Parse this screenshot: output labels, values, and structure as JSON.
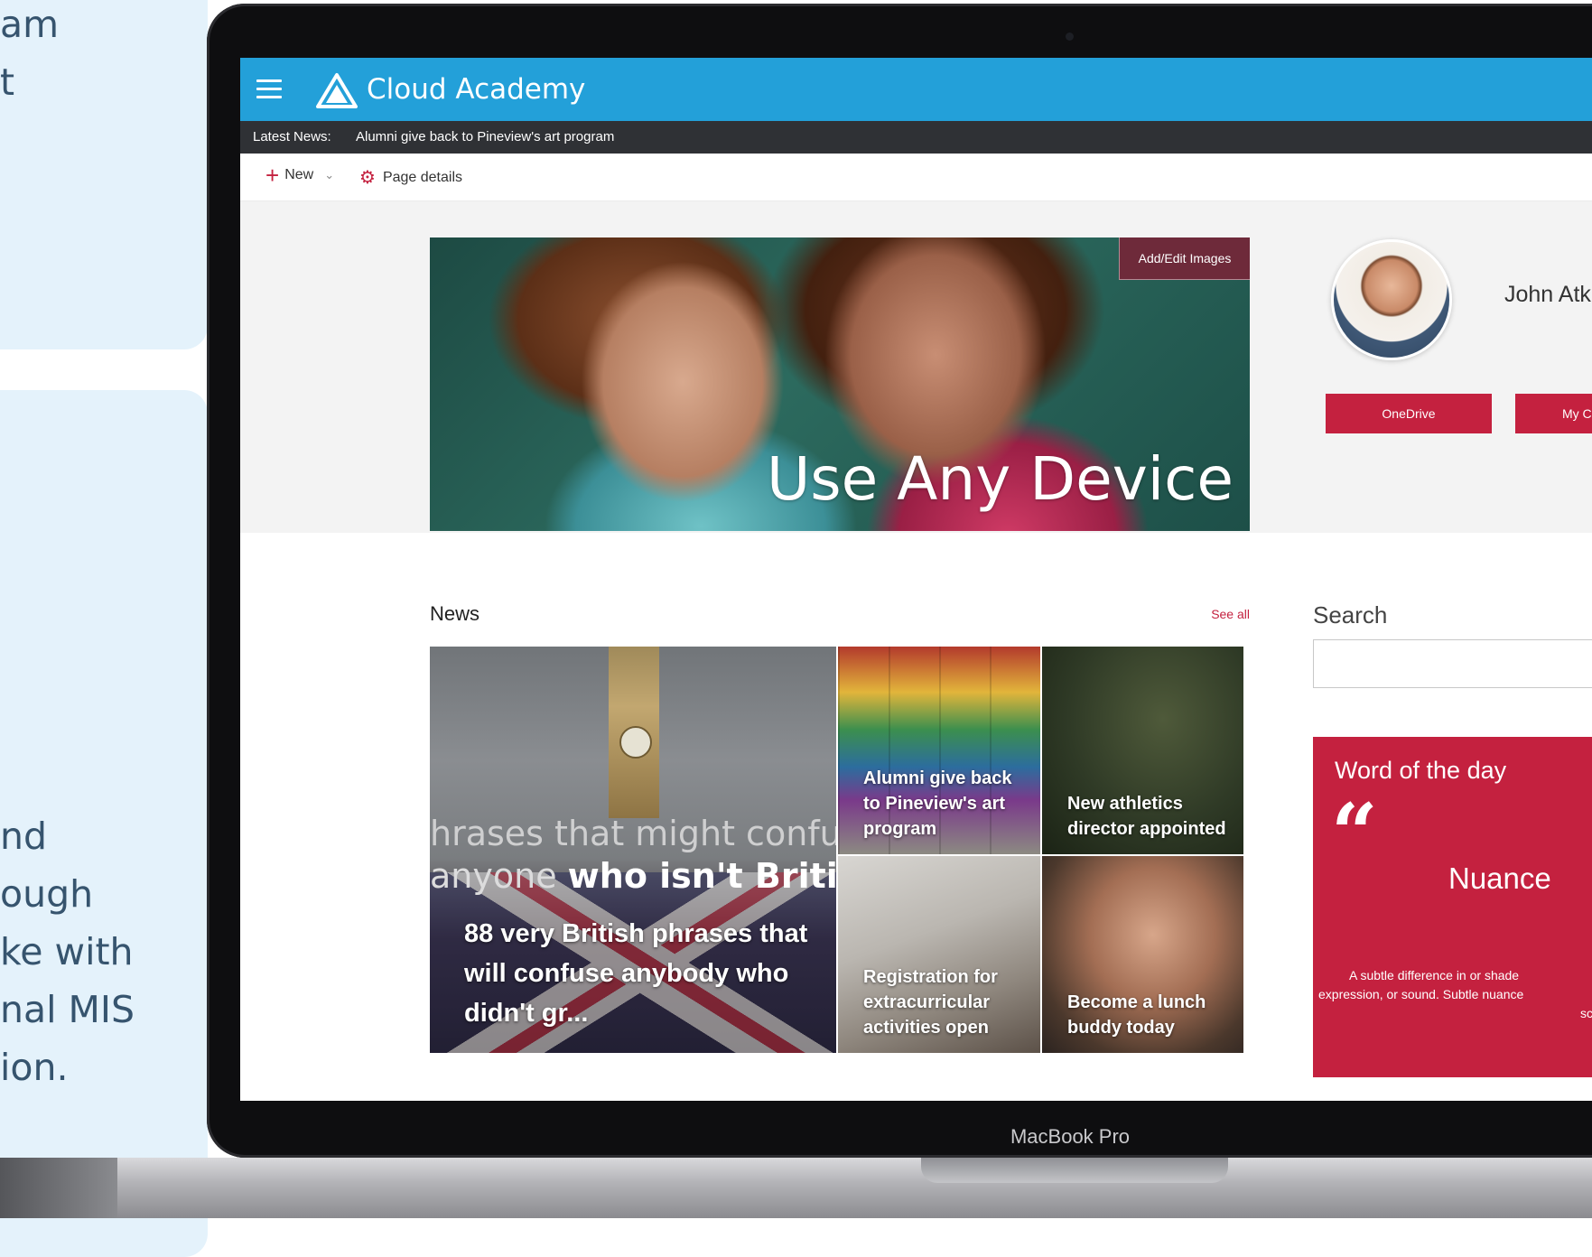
{
  "background": {
    "top_text": [
      "am",
      "t"
    ],
    "bottom_text": [
      "nd",
      "ough",
      "ke with",
      "nal MIS",
      "ion."
    ]
  },
  "laptop": {
    "brand_label": "MacBook Pro"
  },
  "suite_bar": {
    "site_title": "Cloud Academy",
    "accent_color": "#23a0d9",
    "menu_icon": "hamburger-menu-icon",
    "logo_icon": "triangle-logo-icon"
  },
  "news_ticker": {
    "label": "Latest News:",
    "item": "Alumni give back to Pineview's art program"
  },
  "command_bar": {
    "new_label": "New",
    "page_details_label": "Page details"
  },
  "hero": {
    "caption": "Use Any Device",
    "edit_button_label": "Add/Edit Images"
  },
  "profile": {
    "user_name": "John Atk",
    "buttons": [
      {
        "label": "OneDrive"
      },
      {
        "label": "My C"
      }
    ],
    "button_color": "#c4213f"
  },
  "news": {
    "heading": "News",
    "see_all_label": "See all",
    "featured": {
      "overlay_line1": "hrases that might confuse",
      "overlay_line2a": "anyone ",
      "overlay_line2b": "who isn't British",
      "title": "88 very British phrases that will confuse anybody who didn't gr..."
    },
    "tiles": [
      {
        "title": "Alumni give back to Pineview's art program"
      },
      {
        "title": "New athletics director appointed"
      },
      {
        "title": "Registration for extracurricular activities open"
      },
      {
        "title": "Become a lunch buddy today"
      }
    ]
  },
  "search": {
    "label": "Search",
    "value": "",
    "placeholder": ""
  },
  "word_of_the_day": {
    "title": "Word of the day",
    "term": "Nuance",
    "definition_lines": [
      "A subtle difference in or shade",
      "expression, or sound. Subtle nuance",
      "scre"
    ],
    "card_color": "#c4213f"
  }
}
